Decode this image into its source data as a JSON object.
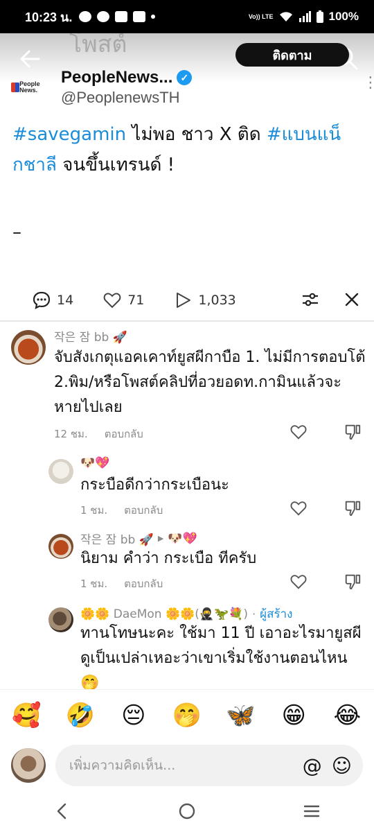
{
  "status_bar": {
    "time": "10:23 น.",
    "network": "Vo)) LTE",
    "battery": "100%"
  },
  "article": {
    "bg_title": "โพสต์",
    "account": {
      "logo_text": "People News.",
      "display_name": "PeopleNews...",
      "handle": "@PeoplenewsTH",
      "follow_label": "ติดตาม"
    },
    "post": {
      "hashtag1": "#savegamin",
      "text1": " ไม่พอ ชาว X ติด ",
      "hashtag2": "#แบนแน็กชาลี",
      "text2": " จนขึ้นเทรนด์ !",
      "dash": "–"
    }
  },
  "stats": {
    "comments": "14",
    "likes": "71",
    "views": "1,033"
  },
  "comments": [
    {
      "name": "작은 잠 bb 🚀",
      "text": "จับสังเกตุแอคเคาท์ยูสผีกาบือ 1. ไม่มีการตอบโต้ 2.พิม/หรือโพสต์คลิปที่อวยอดท.กามินแล้วจะหายไปเลย",
      "time": "12 ชม.",
      "reply": "ตอบกลับ"
    },
    {
      "name": "🐶💖",
      "text": "กระบือดีกว่ากระเบือนะ",
      "time": "1 ชม.",
      "reply": "ตอบกลับ"
    },
    {
      "name": "작은 잠 bb 🚀",
      "reply_to": "🐶💖",
      "text": "นิยาม คำว่า กระเบือ ทีครับ",
      "time": "1 ชม.",
      "reply": "ตอบกลับ"
    },
    {
      "name": "🌼🌼 DaeMon 🌼🌼(🥷🦖💐)",
      "creator": "ผู้สร้าง",
      "text": "ทานโทษนะคะ ใช้มา 11 ปี เอาอะไรมายูสผี ดูเป็นเปล่าเหอะว่าเขาเริ่มใช้งานตอนไหน 🤭"
    }
  ],
  "emojis": [
    "🥰",
    "🤣",
    "😔",
    "🤭",
    "🦋",
    "😁",
    "😂"
  ],
  "input": {
    "placeholder": "เพิ่มความคิดเห็น...",
    "at": "@",
    "emoji_button": "☺"
  }
}
